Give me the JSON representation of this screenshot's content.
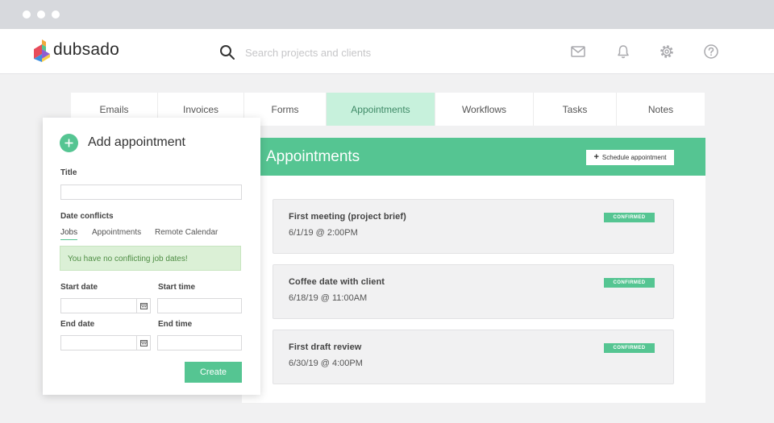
{
  "app": {
    "name": "dubsado"
  },
  "search": {
    "placeholder": "Search projects and clients"
  },
  "tabs": [
    {
      "label": "Emails"
    },
    {
      "label": "Invoices"
    },
    {
      "label": "Forms"
    },
    {
      "label": "Appointments",
      "active": true
    },
    {
      "label": "Workflows"
    },
    {
      "label": "Tasks"
    },
    {
      "label": "Notes"
    }
  ],
  "main": {
    "title": "Appointments",
    "schedule_label": "Schedule appointment",
    "appointments": [
      {
        "title": "First meeting (project brief)",
        "date": "6/1/19 @ 2:00PM",
        "status": "CONFIRMED"
      },
      {
        "title": "Coffee date with client",
        "date": "6/18/19 @ 11:00AM",
        "status": "CONFIRMED"
      },
      {
        "title": "First draft review",
        "date": "6/30/19 @ 4:00PM",
        "status": "CONFIRMED"
      }
    ]
  },
  "modal": {
    "title": "Add appointment",
    "title_label": "Title",
    "title_value": "",
    "date_conflicts_label": "Date conflicts",
    "conflict_tabs": [
      {
        "label": "Jobs",
        "active": true
      },
      {
        "label": "Appointments"
      },
      {
        "label": "Remote Calendar"
      }
    ],
    "notice": "You have no conflicting job dates!",
    "start_date_label": "Start date",
    "start_time_label": "Start time",
    "end_date_label": "End date",
    "end_time_label": "End time",
    "start_date_value": "",
    "start_time_value": "",
    "end_date_value": "",
    "end_time_value": "",
    "create_label": "Create"
  },
  "colors": {
    "accent": "#55c592",
    "active_tab_bg": "#c7f1dc",
    "notice_bg": "#dbf0d6",
    "chrome": "#d7d9dd"
  },
  "icons": {
    "search": "search-icon",
    "mail": "mail-icon",
    "bell": "bell-icon",
    "settings": "gear-icon",
    "help": "help-icon",
    "calendar": "calendar-icon",
    "plus": "plus-icon"
  }
}
